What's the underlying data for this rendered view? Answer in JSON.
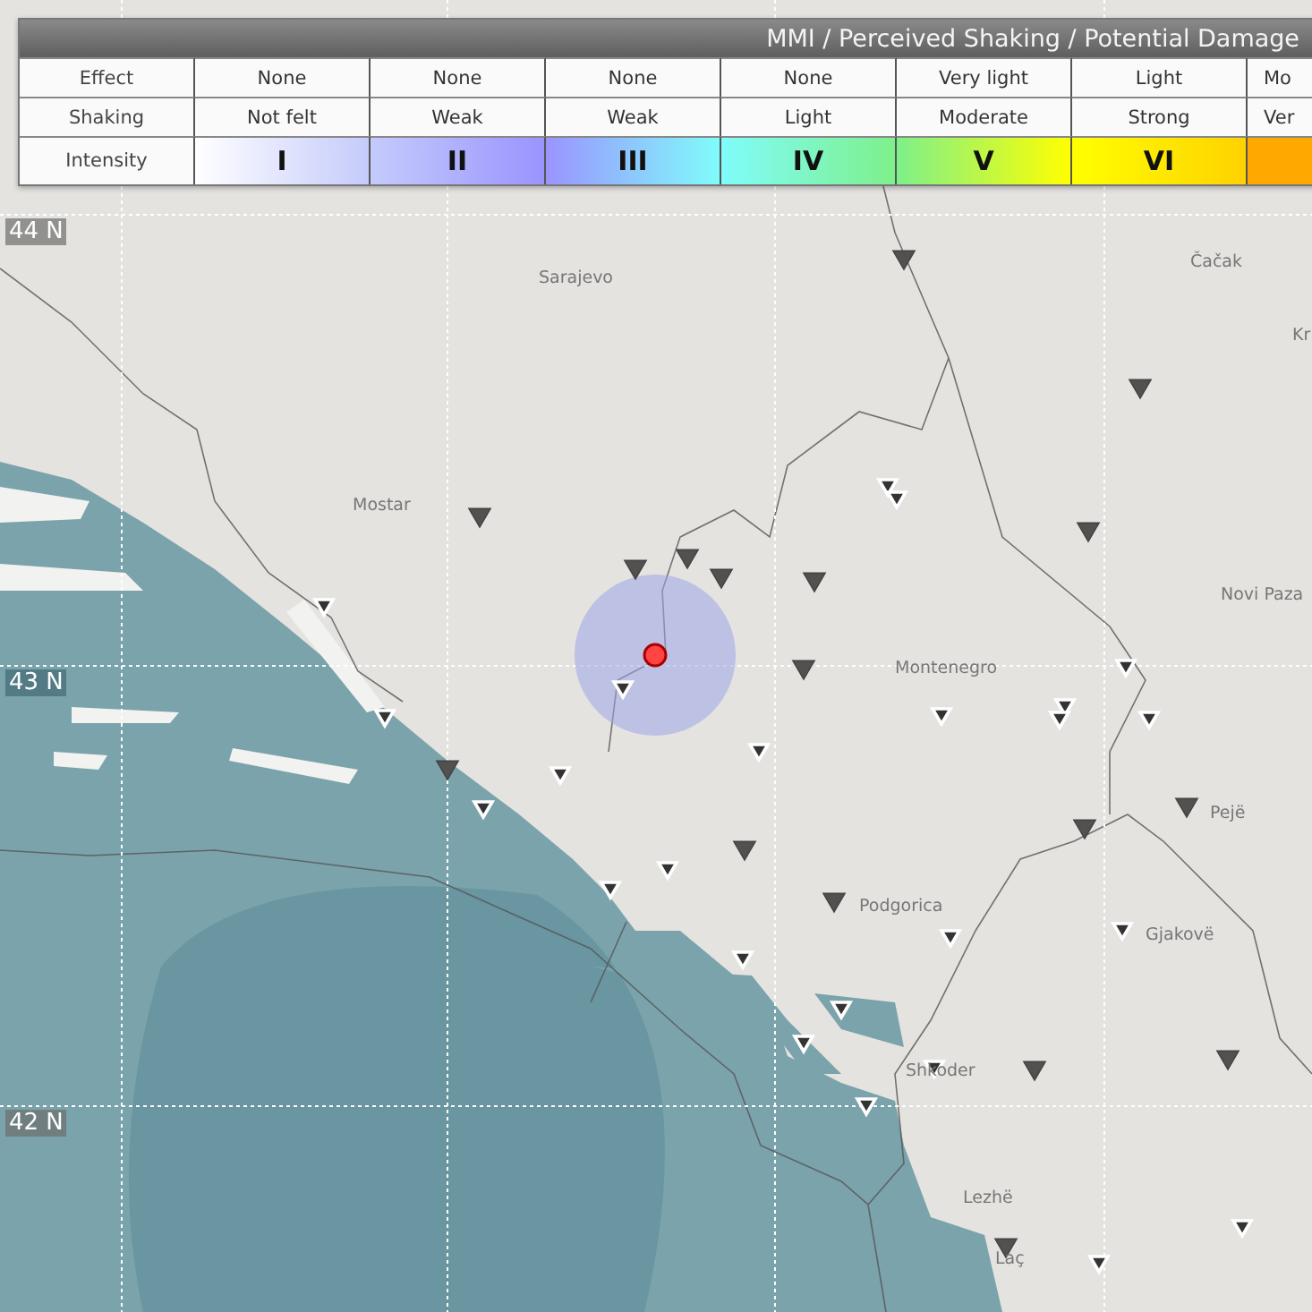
{
  "legend": {
    "title": "MMI / Perceived Shaking / Potential Damage",
    "row_labels": [
      "Effect",
      "Shaking",
      "Intensity"
    ],
    "columns": [
      {
        "effect": "None",
        "shaking": "Not felt",
        "intensity": "I",
        "color": "#c4cbfb"
      },
      {
        "effect": "None",
        "shaking": "Weak",
        "intensity": "II",
        "color": "#9a94ff"
      },
      {
        "effect": "None",
        "shaking": "Weak",
        "intensity": "III",
        "color": "#80fcfb"
      },
      {
        "effect": "None",
        "shaking": "Light",
        "intensity": "IV",
        "color": "#7ef08a"
      },
      {
        "effect": "Very light",
        "shaking": "Moderate",
        "intensity": "V",
        "color": "#ffff00"
      },
      {
        "effect": "Light",
        "shaking": "Strong",
        "intensity": "VI",
        "color": "#ffd200"
      },
      {
        "effect": "Mo",
        "shaking": "Ver",
        "color": "#ffa800"
      }
    ]
  },
  "map": {
    "grid_labels": [
      "44 N",
      "43 N",
      "42 N"
    ],
    "places": [
      "Sarajevo",
      "Čačak",
      "Kr",
      "Mostar",
      "Novi Paza",
      "Montenegro",
      "Pejë",
      "Podgorica",
      "Gjakovë",
      "Shkoder",
      "Lezhë",
      "Laç"
    ],
    "stations": [
      {
        "kind": "felt"
      },
      {
        "kind": "felt"
      },
      {
        "kind": "felt"
      },
      {
        "kind": "felt"
      },
      {
        "kind": "felt"
      },
      {
        "kind": "felt"
      },
      {
        "kind": "felt"
      },
      {
        "kind": "felt"
      },
      {
        "kind": "felt"
      },
      {
        "kind": "felt"
      },
      {
        "kind": "felt"
      },
      {
        "kind": "felt"
      },
      {
        "kind": "felt"
      },
      {
        "kind": "felt"
      },
      {
        "kind": "felt"
      },
      {
        "kind": "felt"
      },
      {
        "kind": "felt"
      },
      {
        "kind": "instrument"
      },
      {
        "kind": "instrument"
      },
      {
        "kind": "instrument"
      },
      {
        "kind": "instrument"
      },
      {
        "kind": "instrument"
      },
      {
        "kind": "instrument"
      },
      {
        "kind": "instrument"
      },
      {
        "kind": "instrument"
      },
      {
        "kind": "instrument"
      },
      {
        "kind": "instrument"
      },
      {
        "kind": "instrument"
      },
      {
        "kind": "instrument"
      },
      {
        "kind": "instrument"
      },
      {
        "kind": "instrument"
      },
      {
        "kind": "instrument"
      },
      {
        "kind": "instrument"
      },
      {
        "kind": "instrument"
      },
      {
        "kind": "instrument"
      },
      {
        "kind": "instrument"
      },
      {
        "kind": "instrument"
      },
      {
        "kind": "instrument"
      },
      {
        "kind": "instrument"
      },
      {
        "kind": "instrument"
      },
      {
        "kind": "instrument"
      }
    ]
  }
}
